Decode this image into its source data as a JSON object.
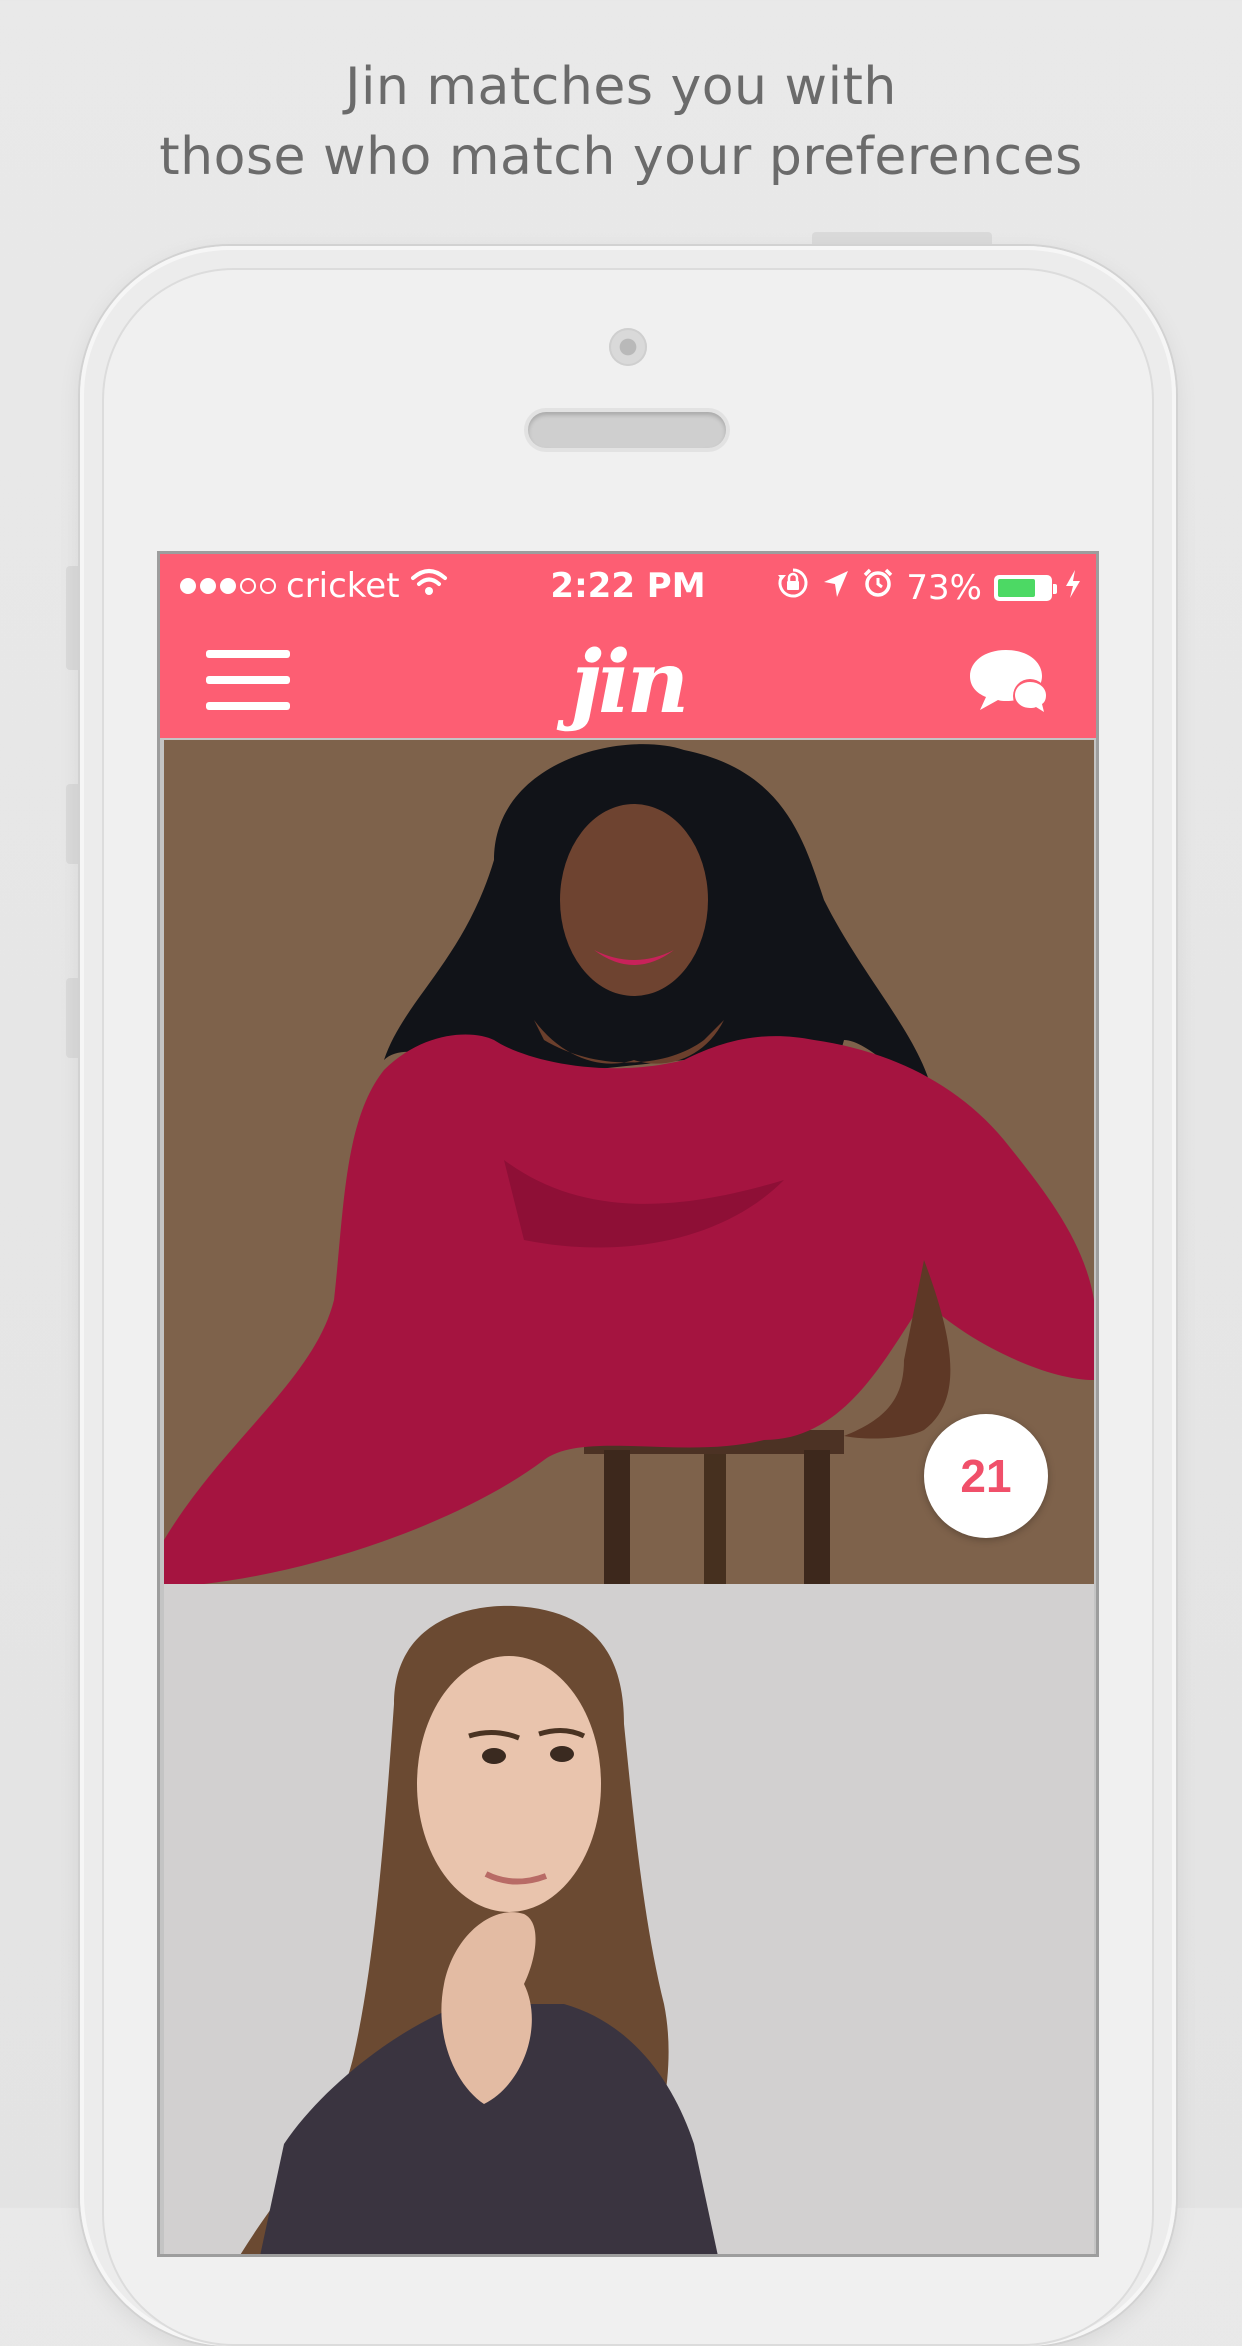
{
  "headline": {
    "line1": "Jin matches you with",
    "line2": "those who match your preferences"
  },
  "status_bar": {
    "carrier": "cricket",
    "time": "2:22 PM",
    "battery_percent": "73%",
    "battery_level": 0.73,
    "signal_bars": 3,
    "signal_total": 5
  },
  "navbar": {
    "logo": "jin"
  },
  "feed": {
    "cards": [
      {
        "age": "21"
      },
      {
        "age": ""
      }
    ]
  },
  "colors": {
    "brand": "#fd5e73",
    "badge_text": "#f0506a",
    "battery_green": "#4cd964"
  },
  "icons": {
    "menu": "hamburger-icon",
    "chat": "chat-bubbles-icon",
    "wifi": "wifi-icon",
    "lock": "orientation-lock-icon",
    "location": "location-arrow-icon",
    "alarm": "alarm-icon",
    "charging": "charging-bolt-icon"
  }
}
